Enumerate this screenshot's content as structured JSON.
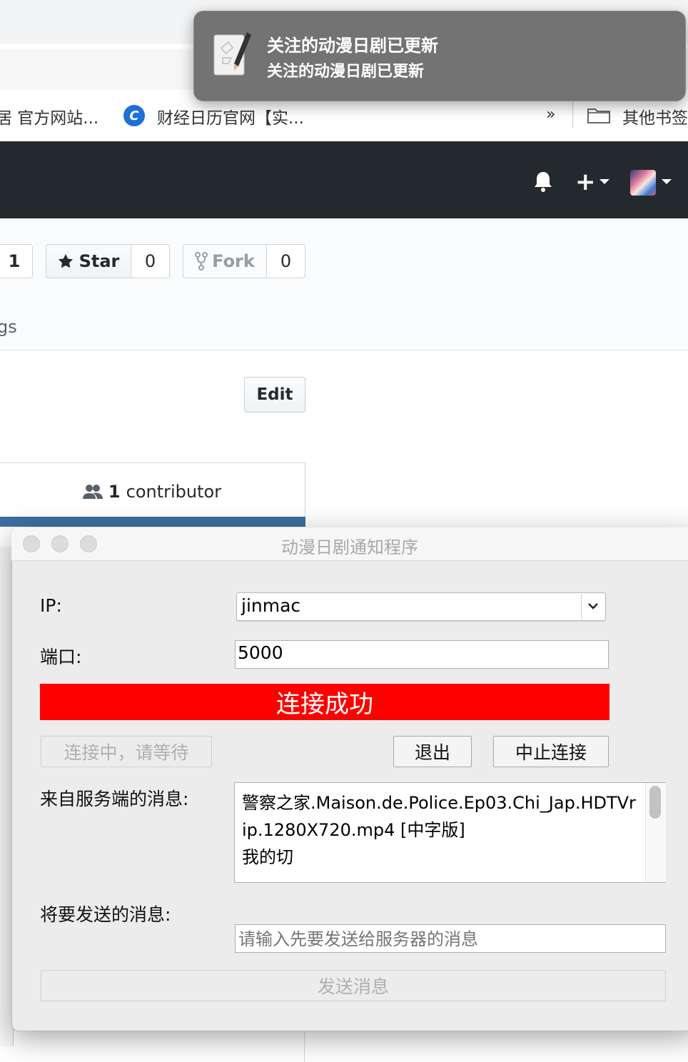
{
  "notification": {
    "title": "关注的动漫日剧已更新",
    "body": "关注的动漫日剧已更新"
  },
  "bookmarks": {
    "item1": "居 官方网站...",
    "item2": "财经日历官网【实...",
    "more": "»",
    "other": "其他书签"
  },
  "repo": {
    "watch_count": "1",
    "star_label": "Star",
    "star_count": "0",
    "fork_label": "Fork",
    "fork_count": "0",
    "tab_fragment": "gs",
    "edit_label": "Edit",
    "contributor_count": "1",
    "contributor_label": "contributor"
  },
  "app": {
    "title": "动漫日剧通知程序",
    "ip_label": "IP:",
    "ip_value": "jinmac",
    "port_label": "端口:",
    "port_value": "5000",
    "status": "连接成功",
    "status_color": "#ff0000",
    "connect_button": "连接中，请等待",
    "exit_button": "退出",
    "stop_button": "中止连接",
    "server_msg_label": "来自服务端的消息:",
    "server_msg": "警察之家.Maison.de.Police.Ep03.Chi_Jap.HDTVrip.1280X720.mp4 [中字版]\n我的切",
    "send_label": "将要发送的消息:",
    "send_placeholder": "请输入先要发送给服务器的消息",
    "send_button": "发送消息"
  }
}
